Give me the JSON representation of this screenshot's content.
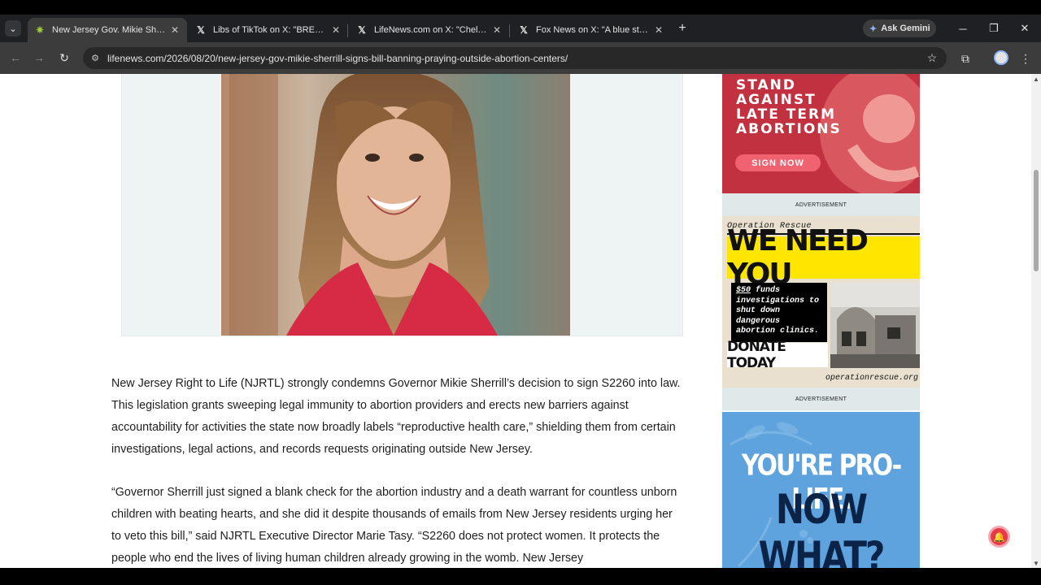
{
  "browser": {
    "tabs": [
      {
        "title": "New Jersey Gov. Mikie Sherrill S",
        "favicon": "lifenews-favicon",
        "active": true
      },
      {
        "title": "Libs of TikTok on X: \"BREAKING:",
        "favicon": "x-icon"
      },
      {
        "title": "LifeNews.com on X: \"Chelsea Cl",
        "favicon": "x-icon"
      },
      {
        "title": "Fox News on X: \"A blue state ju",
        "favicon": "x-icon"
      }
    ],
    "tab_close_glyph": "✕",
    "new_tab_glyph": "+",
    "tab_search_glyph": "⌄",
    "gemini_label": "Ask Gemini",
    "gemini_glyph": "✦",
    "x_glyph": "𝕏",
    "window_controls": {
      "minimize": "─",
      "restore": "❐",
      "close": "✕"
    },
    "nav": {
      "back": "←",
      "forward": "→",
      "reload": "↻"
    },
    "url": "lifenews.com/2026/08/20/new-jersey-gov-mikie-sherrill-signs-bill-banning-praying-outside-abortion-centers/",
    "site_info_glyph": "⚙",
    "bookmark_glyph": "☆",
    "extensions_glyph": "⧉",
    "menu_glyph": "⋮"
  },
  "article": {
    "paragraphs": [
      "New Jersey Right to Life (NJRTL) strongly condemns Governor Mikie Sherrill’s decision to sign S2260 into law. This legislation grants sweeping legal immunity to abortion providers and erects new barriers against accountability for activities the state now broadly labels “reproductive health care,” shielding them from certain investigations, legal actions, and records requests originating outside New Jersey.",
      "“Governor Sherrill just signed a blank check for the abortion industry and a death warrant for countless unborn children with beating hearts, and she did it despite thousands of emails from New Jersey residents urging her to veto this bill,” said NJRTL Executive Director Marie Tasy. “S2260 does not protect women. It protects the people who end the lives of living human children already growing in the womb. New Jersey"
    ]
  },
  "sidebar": {
    "ad1": {
      "headline": "STAND AGAINST LATE TERM ABORTIONS",
      "button": "SIGN NOW"
    },
    "ad_label": "ADVERTISEMENT",
    "ad2": {
      "org": "Operation Rescue",
      "headline": "WE NEED YOU",
      "amount": "$50",
      "body": "funds investigations to shut down dangerous abortion clinics.",
      "cta": "DONATE TODAY",
      "website": "operationrescue.org"
    },
    "ad3": {
      "line1": "YOU'RE PRO-LIFE.",
      "line2": "NOW WHAT?"
    }
  },
  "notification_glyph": "🔔",
  "scroll": {
    "up": "▲",
    "down": "▼"
  },
  "colors": {
    "accent_red": "#e8394b",
    "ad_blue": "#5ea2de",
    "ad_yellow": "#ffe600"
  }
}
